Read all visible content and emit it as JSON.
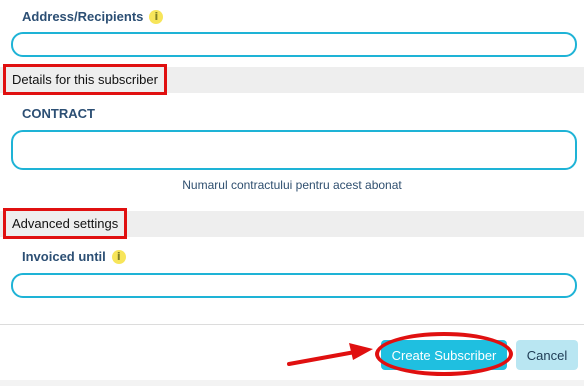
{
  "form": {
    "address_label": "Address/Recipients",
    "address_value": "",
    "section_details": "Details for this subscriber",
    "contract_label": "CONTRACT",
    "contract_value": "",
    "contract_help": "Numarul contractului pentru acest abonat",
    "section_advanced": "Advanced settings",
    "invoiced_label": "Invoiced until",
    "invoiced_value": ""
  },
  "icons": {
    "info": "i"
  },
  "footer": {
    "create_label": "Create Subscriber",
    "cancel_label": "Cancel"
  },
  "colors": {
    "accent": "#1fbfe0",
    "label": "#2c4f74",
    "annotation": "#e01010",
    "info_icon": "#f7e55a"
  }
}
